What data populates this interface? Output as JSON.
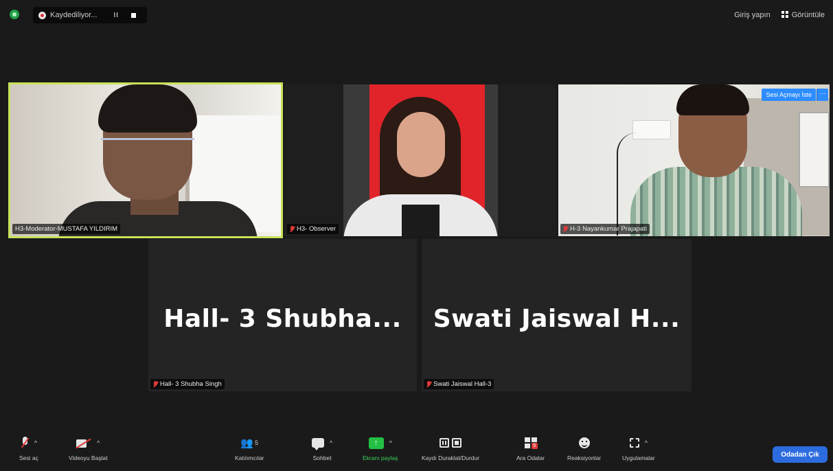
{
  "top_bar": {
    "recording_label": "Kaydediliyor...",
    "pause_glyph": "II",
    "exit_fullscreen_label": "Giriş yapın",
    "view_label": "Görüntüle"
  },
  "participants": [
    {
      "name": "H3-Moderator-MUSTAFA YILDIRIM",
      "video": true,
      "active_speaker": true,
      "muted": false
    },
    {
      "name": "H3- Observer",
      "video": true,
      "muted": true
    },
    {
      "name": "H-3 Nayankumar Prajapati",
      "video": true,
      "muted": true,
      "spotlight_label": "Sesi Açmayı İste",
      "more_glyph": "···"
    },
    {
      "name": "Hall- 3 Shubha Singh",
      "display_name": "Hall- 3 Shubha...",
      "video": false,
      "muted": true
    },
    {
      "name": "Swati Jaiswal Hall-3",
      "display_name": "Swati Jaiswal H...",
      "video": false,
      "muted": true
    }
  ],
  "toolbar": {
    "unmute_label": "Sesi aç",
    "start_video_label": "Videoyu Başlat",
    "participants_label": "Katılımcılar",
    "participants_count": "5",
    "chat_label": "Sohbet",
    "share_label": "Ekranı paylaş",
    "share_glyph": "↑",
    "record_label": "Kaydı Duraklat/Durdur",
    "rooms_label": "Ara Odalar",
    "reactions_label": "Reaksiyonlar",
    "apps_label": "Uygulamalar",
    "leave_label": "Odadan Çık",
    "caret_glyph": "^"
  },
  "colors": {
    "background": "#1a1a1a",
    "active_speaker_border": "#c8e25a",
    "share_green": "#23c045",
    "leave_blue": "#2d6cdf",
    "muted_red": "#e03a3a"
  }
}
